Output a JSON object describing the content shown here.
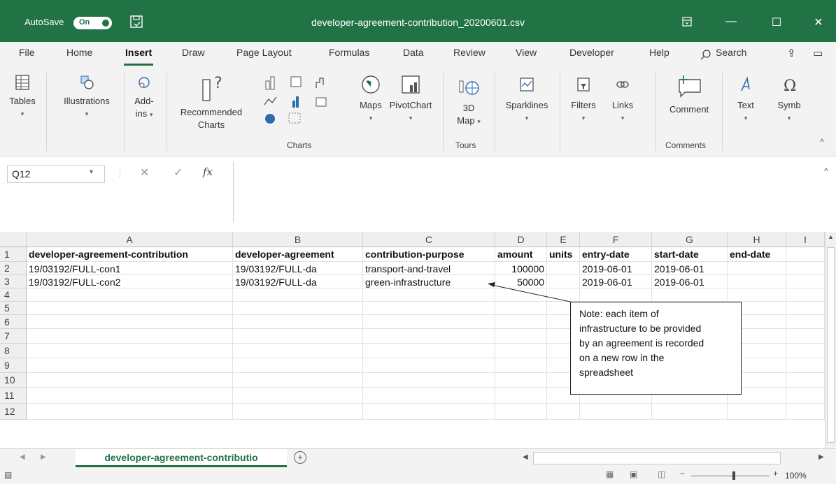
{
  "titlebar": {
    "autosave_label": "AutoSave",
    "autosave_state": "On",
    "document_title": "developer-agreement-contribution_20200601.csv",
    "accent_color": "#217346"
  },
  "tabs": [
    "File",
    "Home",
    "Insert",
    "Draw",
    "Page Layout",
    "Formulas",
    "Data",
    "Review",
    "View",
    "Developer",
    "Help"
  ],
  "active_tab": "Insert",
  "search_label": "Search",
  "ribbon": {
    "tables": "Tables",
    "illustrations": "Illustrations",
    "addins_1": "Add-",
    "addins_2": "ins",
    "recommended_1": "Recommended",
    "recommended_2": "Charts",
    "maps": "Maps",
    "pivotchart": "PivotChart",
    "map3d_1": "3D",
    "map3d_2": "Map",
    "sparklines": "Sparklines",
    "filters": "Filters",
    "links": "Links",
    "comment": "Comment",
    "text": "Text",
    "symbols": "Symb",
    "group_charts": "Charts",
    "group_tours": "Tours",
    "group_comments": "Comments"
  },
  "formula_bar": {
    "name_box": "Q12",
    "fx": "fx",
    "value": ""
  },
  "columns": [
    "A",
    "B",
    "C",
    "D",
    "E",
    "F",
    "G",
    "H",
    "I"
  ],
  "row_numbers": [
    "1",
    "2",
    "3",
    "4",
    "5",
    "6",
    "7",
    "8",
    "9",
    "10",
    "11",
    "12"
  ],
  "rows": [
    [
      "developer-agreement-contribution",
      "developer-agreement",
      "contribution-purpose",
      "amount",
      "units",
      "entry-date",
      "start-date",
      "end-date",
      ""
    ],
    [
      "19/03192/FULL-con1",
      "19/03192/FULL-da",
      "transport-and-travel",
      "100000",
      "",
      "2019-06-01",
      "2019-06-01",
      "",
      ""
    ],
    [
      "19/03192/FULL-con2",
      "19/03192/FULL-da",
      "green-infrastructure",
      "50000",
      "",
      "2019-06-01",
      "2019-06-01",
      "",
      ""
    ]
  ],
  "note": {
    "line1": "Note: each item of",
    "line2": "infrastructure to be provided",
    "line3": "by an agreement is recorded",
    "line4": "on a new row in the",
    "line5": "spreadsheet"
  },
  "sheet_tab": "developer-agreement-contributio",
  "zoom": "100%"
}
